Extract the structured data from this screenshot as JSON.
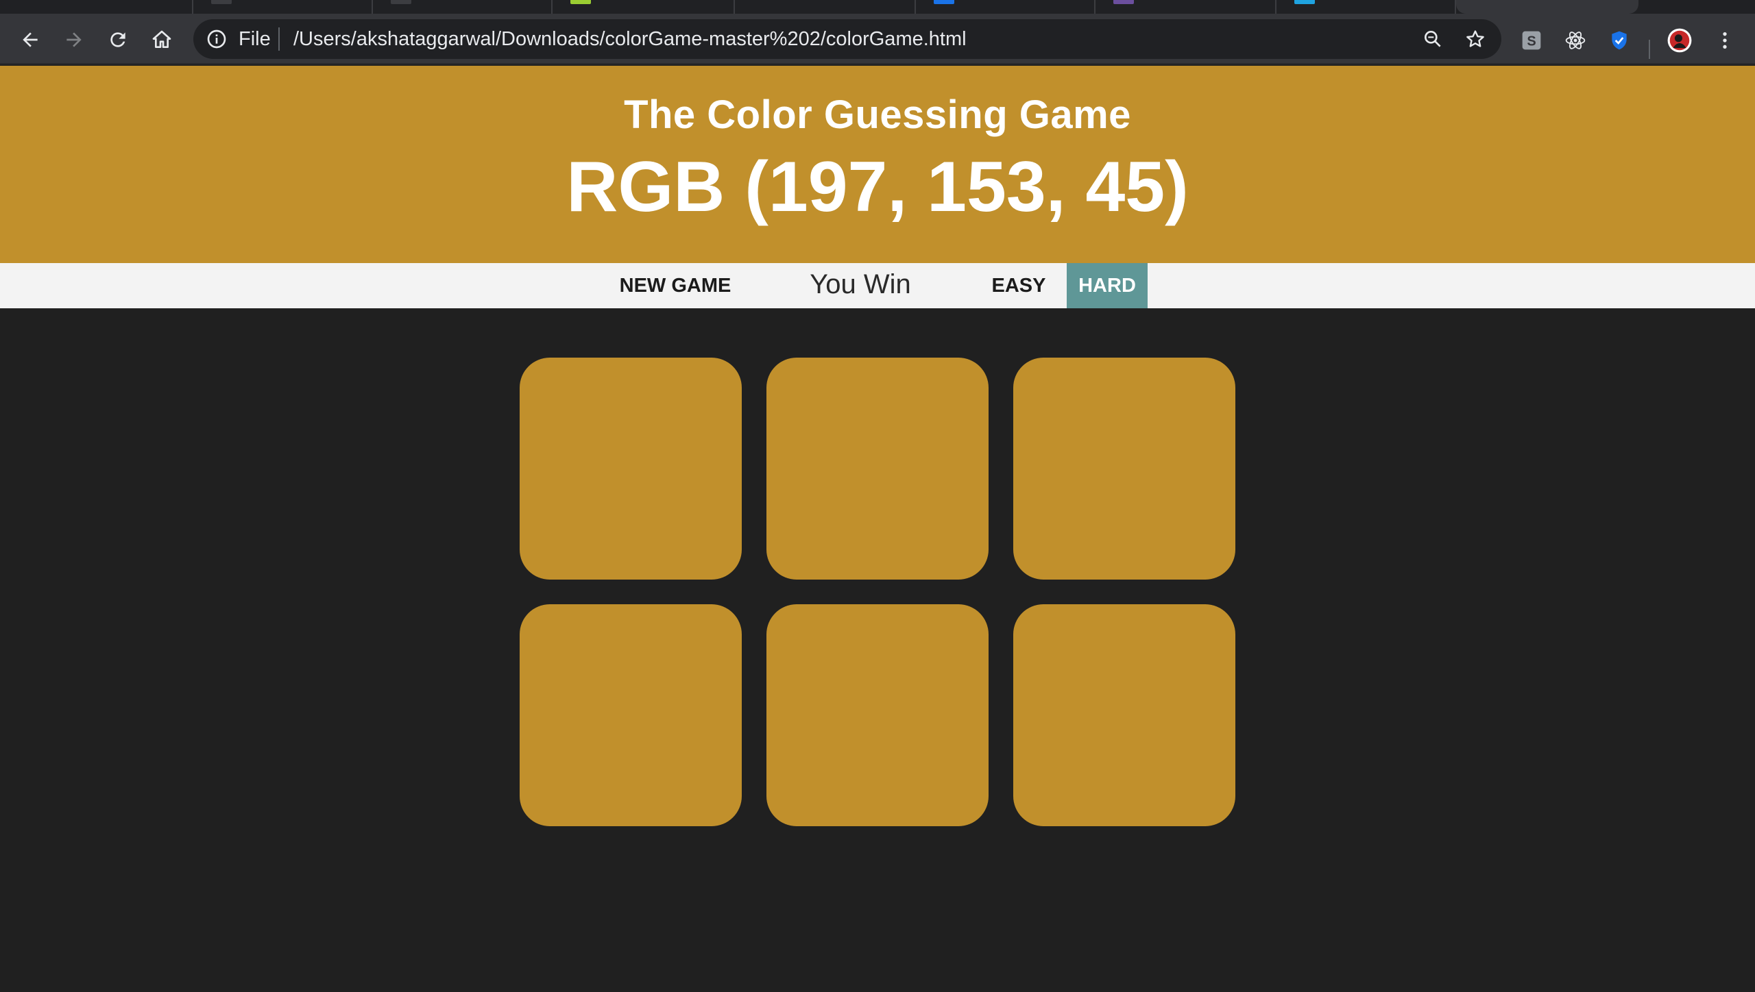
{
  "browser": {
    "url_scheme": "File",
    "url": "/Users/akshataggarwal/Downloads/colorGame-master%202/colorGame.html",
    "tabs": [
      {
        "favicon_color": "#35363a"
      },
      {
        "favicon_color": "#35363a"
      },
      {
        "favicon_color": "#35363a"
      },
      {
        "favicon_color": "#9acd32"
      },
      {
        "favicon_color": "#35363a"
      },
      {
        "favicon_color": "#1a73e8"
      },
      {
        "favicon_color": "#6b4f9e"
      },
      {
        "favicon_color": "#1fa3e0"
      },
      {
        "favicon_color": "#35363a",
        "active": true
      }
    ],
    "icons": [
      "back-arrow-icon",
      "forward-arrow-icon",
      "reload-icon",
      "home-icon",
      "info-icon",
      "zoom-icon",
      "star-icon",
      "extension-s-icon",
      "react-devtools-icon",
      "shield-icon",
      "profile-avatar-icon",
      "more-menu-icon"
    ]
  },
  "game": {
    "title": "The Color Guessing Game",
    "target_rgb": "RGB (197, 153, 45)",
    "header_color": "#c1902c",
    "new_game_label": "New Game",
    "message": "You Win",
    "easy_label": "Easy",
    "hard_label": "Hard",
    "selected_mode": "Hard",
    "mode_selected_color": "#5f9797",
    "squares": [
      "#c1902c",
      "#c1902c",
      "#c1902c",
      "#c1902c",
      "#c1902c",
      "#c1902c"
    ]
  }
}
